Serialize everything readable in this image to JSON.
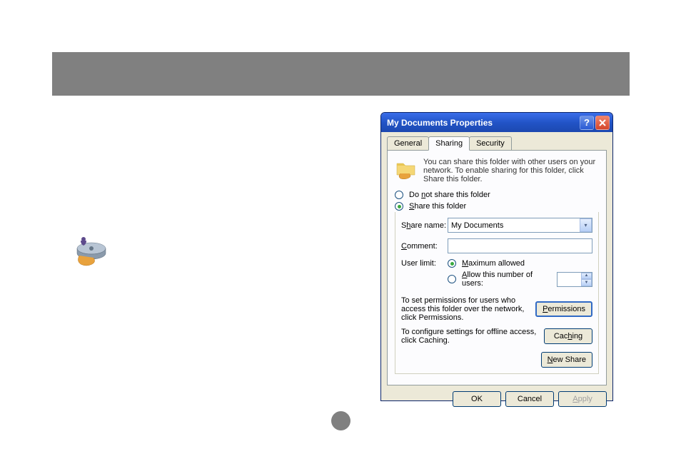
{
  "dialog": {
    "title": "My Documents Properties",
    "tabs": {
      "general": "General",
      "sharing": "Sharing",
      "security": "Security"
    },
    "intro": "You can share this folder with other users on your network.  To enable sharing for this folder, click Share this folder.",
    "radio_not_share": "Do not share this folder",
    "radio_share": "Share this folder",
    "share_name_label": "Share name:",
    "share_name_value": "My Documents",
    "comment_label": "Comment:",
    "comment_value": "",
    "user_limit_label": "User limit:",
    "max_allowed": "Maximum allowed",
    "allow_number": "Allow this number of users:",
    "allow_number_value": "",
    "perm_text": "To set permissions for users who access this folder over the network, click Permissions.",
    "perm_button": "Permissions",
    "cache_text": "To configure settings for offline access, click Caching.",
    "cache_button": "Caching",
    "new_share_button": "New Share",
    "ok": "OK",
    "cancel": "Cancel",
    "apply": "Apply"
  },
  "accents": {
    "not_share_accel": "n",
    "share_accel": "S",
    "share_name_accel": "h",
    "comment_accel": "C",
    "max_accel": "M",
    "allow_accel": "A",
    "perm_accel": "P",
    "cache_accel": "h",
    "new_share_accel": "N",
    "apply_accel": "A"
  }
}
